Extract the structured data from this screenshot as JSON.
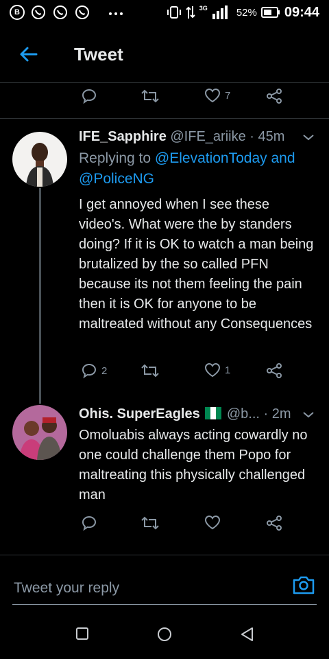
{
  "status_bar": {
    "icons": [
      "b-circle-icon",
      "whatsapp-icon",
      "whatsapp-icon",
      "whatsapp-icon",
      "more-dots-icon",
      "vibrate-icon",
      "data-arrows-icon",
      "signal-3g-icon",
      "signal-icon"
    ],
    "network": "3G",
    "battery": "52%",
    "time": "09:44"
  },
  "header": {
    "title": "Tweet"
  },
  "top_actions": {
    "like_count": "7"
  },
  "tweets": [
    {
      "name": "IFE_Sapphire",
      "handle": "@IFE_ariike",
      "time": "· 45m",
      "replying_prefix": "Replying to ",
      "mention_1": "@ElevationToday and",
      "mention_2": "@PoliceNG",
      "body": "I get annoyed when I see these video's. What were the by standers doing? If it is OK to watch a man being brutalized by the so called PFN because its not them feeling the pain then it is OK for anyone to be maltreated without any Consequences",
      "reply_count": "2",
      "retweet_count": "",
      "like_count": "1"
    },
    {
      "name": "Ohis. SuperEagles",
      "handle": "@b...",
      "time": "· 2m",
      "body": "Omoluabis always acting cowardly no one could challenge them Popo for maltreating this physically challenged man",
      "reply_count": "",
      "retweet_count": "",
      "like_count": ""
    }
  ],
  "composer": {
    "placeholder": "Tweet your reply"
  },
  "colors": {
    "background": "#000000",
    "accent": "#1d9bf0",
    "muted": "#8b98a5",
    "flag_green": "#008751"
  }
}
